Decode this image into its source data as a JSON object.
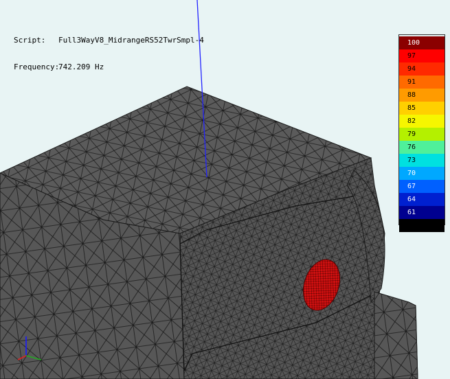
{
  "info": {
    "script_label": "Script:",
    "script_value": "Full3WayV8_MidrangeRS52TwrSmpl-4",
    "frequency_label": "Frequency:",
    "frequency_value": "742.209 Hz"
  },
  "legend": {
    "values": [
      "100",
      "97",
      "94",
      "91",
      "88",
      "85",
      "82",
      "79",
      "76",
      "73",
      "70",
      "67",
      "64",
      "61"
    ],
    "colors": [
      "#8b0000",
      "#ff0000",
      "#ff2a00",
      "#ff6a00",
      "#ff9b00",
      "#ffd000",
      "#f6f600",
      "#b4f000",
      "#4ff09a",
      "#00e0e0",
      "#00a8ff",
      "#0060ff",
      "#0020d0",
      "#000090",
      "#000000"
    ]
  },
  "colors": {
    "background": "#e8f4f4",
    "mesh_face": "#595959",
    "mesh_line": "#1a1a1a",
    "hotspot": "#cc1111",
    "probe_line": "#2222ff"
  }
}
